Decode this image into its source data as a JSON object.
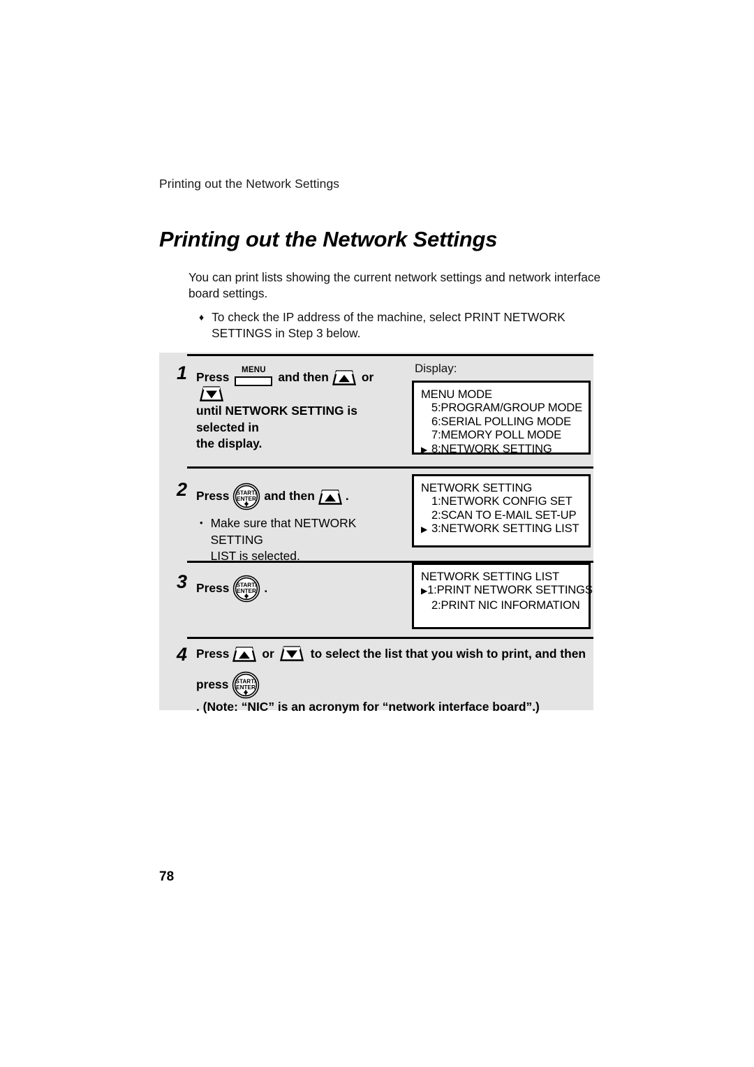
{
  "running_header": "Printing out the Network Settings",
  "page_title": "Printing out the Network Settings",
  "intro": {
    "paragraph": "You can print lists showing the current network settings and network interface board settings.",
    "bullet_marker": "♦",
    "bullet_text": "To check the IP address of the machine, select PRINT NETWORK SETTINGS in Step 3 below."
  },
  "display_label": "Display:",
  "buttons": {
    "menu_label": "MENU",
    "enter_label_top": "START/",
    "enter_label_bottom": "ENTER",
    "up_arrow_name": "up-arrow-button",
    "down_arrow_name": "down-arrow-button"
  },
  "steps": [
    {
      "number": "1",
      "press_word": "Press",
      "mid_text": "and then",
      "or_text": "or",
      "line2": "until NETWORK SETTING is selected in",
      "line3": "the display."
    },
    {
      "number": "2",
      "press_word": "Press",
      "mid_text": "and then",
      "trailing": ".",
      "note_bullet": "•",
      "note_line1": "Make sure that NETWORK SETTING",
      "note_line2": "LIST is selected."
    },
    {
      "number": "3",
      "press_word": "Press",
      "trailing": "."
    },
    {
      "number": "4",
      "press_word": "Press",
      "or_text": "or",
      "tail_text": "to select the list that you wish to print, and then",
      "line2_lead": "press",
      "line2_tail": ". (Note: “NIC” is an acronym for “network interface board”.)"
    }
  ],
  "lcd_screens": [
    {
      "name": "menu-mode-screen",
      "lines": [
        {
          "marker": "",
          "text": "MENU MODE"
        },
        {
          "marker": "",
          "text": "5:PROGRAM/GROUP MODE",
          "indent": true
        },
        {
          "marker": "",
          "text": "6:SERIAL POLLING MODE",
          "indent": true
        },
        {
          "marker": "",
          "text": "7:MEMORY POLL MODE",
          "indent": true
        },
        {
          "marker": "▶",
          "text": "8:NETWORK SETTING"
        }
      ]
    },
    {
      "name": "network-setting-screen",
      "lines": [
        {
          "marker": "",
          "text": "NETWORK SETTING"
        },
        {
          "marker": "",
          "text": "1:NETWORK CONFIG SET",
          "indent": true
        },
        {
          "marker": "",
          "text": "2:SCAN TO E-MAIL SET-UP",
          "indent": true
        },
        {
          "marker": "▶",
          "text": "3:NETWORK SETTING LIST"
        }
      ]
    },
    {
      "name": "network-setting-list-screen",
      "lines": [
        {
          "marker": "",
          "text": "NETWORK SETTING LIST"
        },
        {
          "marker": "▶",
          "text": "1:PRINT NETWORK SETTINGS"
        },
        {
          "marker": "",
          "text": "2:PRINT NIC INFORMATION",
          "indent": true
        }
      ]
    }
  ],
  "page_number": "78",
  "colors": {
    "panel_gray": "#e4e4e4",
    "ink": "#000000",
    "paper": "#ffffff"
  }
}
